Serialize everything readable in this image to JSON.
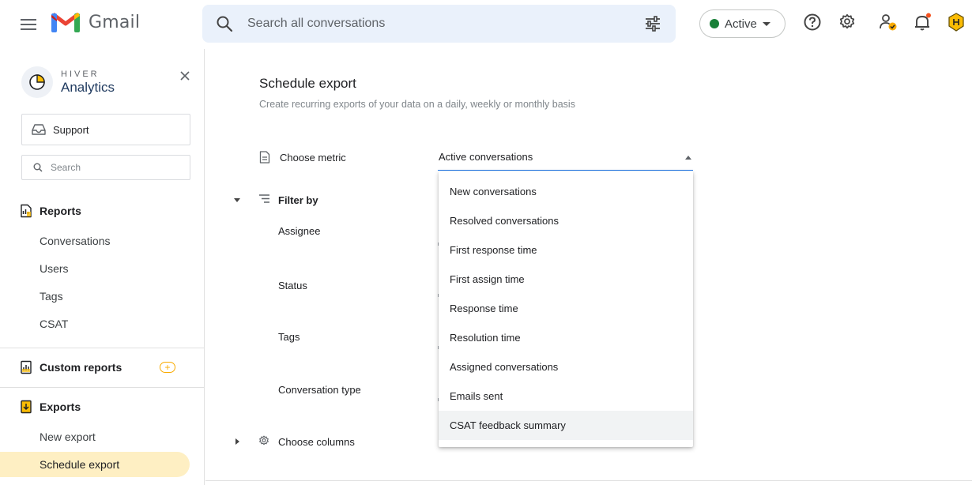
{
  "topbar": {
    "app_name": "Gmail",
    "search": {
      "placeholder": "Search all conversations"
    },
    "status": {
      "label": "Active",
      "color": "#188038"
    },
    "icons": [
      "menu-icon",
      "search-icon",
      "tune-icon",
      "help-icon",
      "gear-icon",
      "person-status-icon",
      "bell-icon",
      "hiver-extension-icon"
    ]
  },
  "sidebar": {
    "brand": {
      "top": "HIVER",
      "bottom": "Analytics"
    },
    "inbox": {
      "label": "Support"
    },
    "search": {
      "placeholder": "Search"
    },
    "reports": {
      "label": "Reports",
      "items": [
        "Conversations",
        "Users",
        "Tags",
        "CSAT"
      ]
    },
    "custom_reports": {
      "label": "Custom reports",
      "badge": "+"
    },
    "exports": {
      "label": "Exports",
      "items": [
        "New export",
        "Schedule export"
      ],
      "active": "Schedule export"
    }
  },
  "main": {
    "title": "Schedule export",
    "subtitle": "Create recurring exports of your data on a daily, weekly or monthly basis",
    "choose_metric": {
      "label": "Choose metric",
      "value": "Active conversations"
    },
    "filter_by": {
      "label": "Filter by",
      "fields": [
        "Assignee",
        "Status",
        "Tags",
        "Conversation type"
      ]
    },
    "choose_columns": {
      "label": "Choose columns"
    },
    "metric_options": [
      "New conversations",
      "Resolved conversations",
      "First response time",
      "First assign time",
      "Response time",
      "Resolution time",
      "Assigned conversations",
      "Emails sent",
      "CSAT feedback summary"
    ],
    "hovered_option": "CSAT feedback summary"
  }
}
